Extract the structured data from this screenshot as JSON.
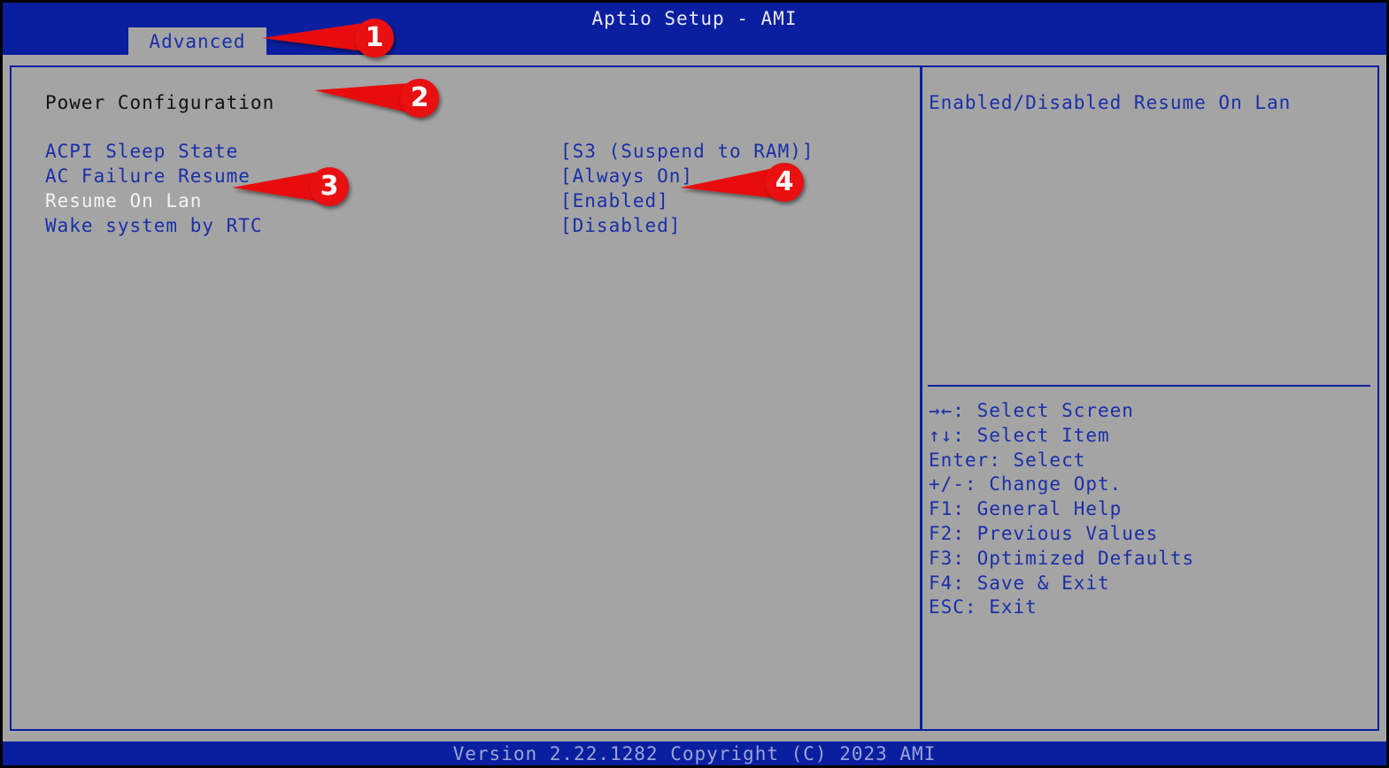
{
  "window": {
    "title": "Aptio Setup - AMI",
    "active_tab": "Advanced"
  },
  "section": {
    "title": "Power Configuration"
  },
  "settings": [
    {
      "label": "ACPI Sleep State",
      "value": "[S3 (Suspend to RAM)]"
    },
    {
      "label": "AC Failure Resume",
      "value": "[Always On]"
    },
    {
      "label": "Resume On Lan",
      "value": "[Enabled]"
    },
    {
      "label": "Wake system by RTC",
      "value": "[Disabled]"
    }
  ],
  "selected_setting": "Resume On Lan",
  "help": {
    "text": "Enabled/Disabled Resume On Lan"
  },
  "keys": [
    "→←: Select Screen",
    "↑↓: Select Item",
    "Enter: Select",
    "+/-: Change Opt.",
    "F1: General Help",
    "F2: Previous Values",
    "F3: Optimized Defaults",
    "F4: Save & Exit",
    "ESC: Exit"
  ],
  "footer": {
    "text": "Version 2.22.1282 Copyright (C) 2023 AMI"
  },
  "annotations": [
    "1",
    "2",
    "3",
    "4"
  ],
  "colors": {
    "bios_blue": "#0a1fa0",
    "panel_gray": "#a4a4a4",
    "item_blue": "#1a2fa8",
    "selected_white": "#f4f4f4",
    "callout_red": "#e81010"
  }
}
